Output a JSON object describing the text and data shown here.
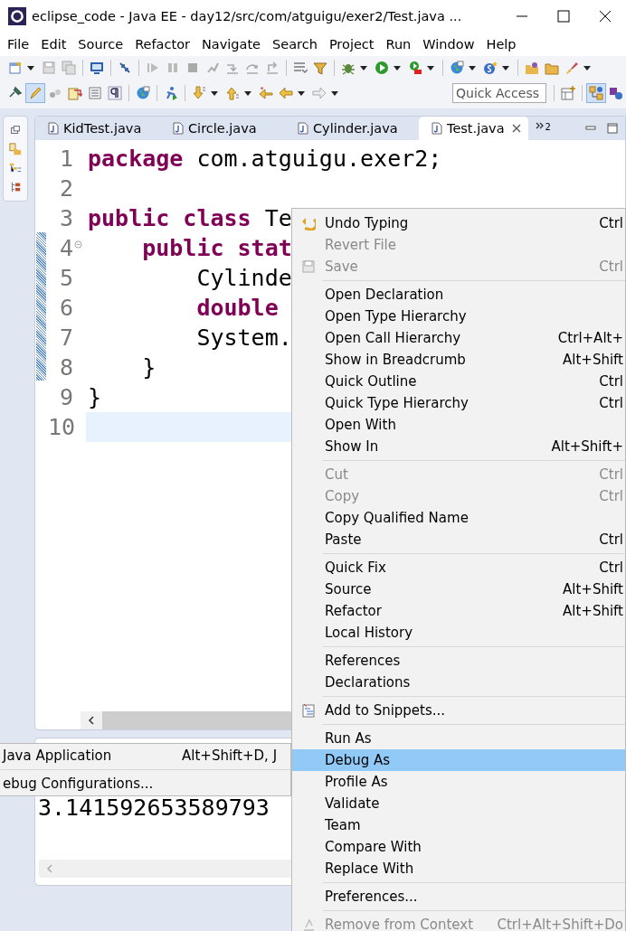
{
  "window": {
    "title": "eclipse_code - Java EE - day12/src/com/atguigu/exer2/Test.java ..."
  },
  "menu_bar": [
    "File",
    "Edit",
    "Source",
    "Refactor",
    "Navigate",
    "Search",
    "Project",
    "Run",
    "Window",
    "Help"
  ],
  "quick_access": {
    "placeholder": "Quick Access"
  },
  "editor": {
    "tabs": [
      {
        "label": "KidTest.java",
        "selected": false
      },
      {
        "label": "Circle.java",
        "selected": false
      },
      {
        "label": "Cylinder.java",
        "selected": false
      },
      {
        "label": "Test.java",
        "selected": true
      }
    ],
    "overflow_count": "2",
    "lines": [
      {
        "number": "1",
        "current": false,
        "tokens": [
          {
            "text": "package",
            "kind": "keyword"
          },
          {
            "text": " com.atguigu.exer2;",
            "kind": "plain"
          }
        ]
      },
      {
        "number": "2",
        "current": false
      },
      {
        "number": "3",
        "current": false,
        "tokens": [
          {
            "text": "public class",
            "kind": "keyword"
          },
          {
            "text": " Te",
            "kind": "plain"
          }
        ]
      },
      {
        "number": "4",
        "current": false,
        "tokens": [
          {
            "text": "    public stat",
            "kind": "keyword"
          }
        ]
      },
      {
        "number": "5",
        "current": false,
        "tokens": [
          {
            "text": "        Cylinde",
            "kind": "plain"
          }
        ]
      },
      {
        "number": "6",
        "current": false,
        "tokens": [
          {
            "text": "        double",
            "kind": "keyword"
          }
        ]
      },
      {
        "number": "7",
        "current": false,
        "tokens": [
          {
            "text": "        System.",
            "kind": "plain"
          }
        ]
      },
      {
        "number": "8",
        "current": false,
        "tokens": [
          {
            "text": "    }",
            "kind": "plain"
          }
        ]
      },
      {
        "number": "9",
        "current": false,
        "tokens": [
          {
            "text": "}",
            "kind": "plain"
          }
        ]
      },
      {
        "number": "10",
        "current": true
      }
    ]
  },
  "console": {
    "output": "3.141592653589793"
  },
  "context_menu": {
    "sections": [
      [
        {
          "label": "Undo Typing",
          "shortcut": "Ctrl",
          "disabled": false,
          "selected": false,
          "kind": "undo"
        },
        {
          "label": "Revert File",
          "disabled": true,
          "selected": false,
          "kind": "plain"
        },
        {
          "label": "Save",
          "shortcut": "Ctrl",
          "disabled": true,
          "selected": false,
          "kind": "save"
        }
      ],
      [
        {
          "label": "Open Declaration",
          "disabled": false,
          "selected": false,
          "kind": "plain"
        },
        {
          "label": "Open Type Hierarchy",
          "disabled": false,
          "selected": false,
          "kind": "plain"
        },
        {
          "label": "Open Call Hierarchy",
          "shortcut": "Ctrl+Alt+",
          "disabled": false,
          "selected": false,
          "kind": "plain"
        },
        {
          "label": "Show in Breadcrumb",
          "shortcut": "Alt+Shift",
          "disabled": false,
          "selected": false,
          "kind": "plain"
        },
        {
          "label": "Quick Outline",
          "shortcut": "Ctrl",
          "disabled": false,
          "selected": false,
          "kind": "plain"
        },
        {
          "label": "Quick Type Hierarchy",
          "shortcut": "Ctrl",
          "disabled": false,
          "selected": false,
          "kind": "plain"
        },
        {
          "label": "Open With",
          "disabled": false,
          "selected": false,
          "kind": "plain"
        },
        {
          "label": "Show In",
          "shortcut": "Alt+Shift+",
          "disabled": false,
          "selected": false,
          "kind": "plain"
        }
      ],
      [
        {
          "label": "Cut",
          "shortcut": "Ctrl",
          "disabled": true,
          "selected": false,
          "kind": "plain"
        },
        {
          "label": "Copy",
          "shortcut": "Ctrl",
          "disabled": true,
          "selected": false,
          "kind": "plain"
        },
        {
          "label": "Copy Qualified Name",
          "disabled": false,
          "selected": false,
          "kind": "plain"
        },
        {
          "label": "Paste",
          "shortcut": "Ctrl",
          "disabled": false,
          "selected": false,
          "kind": "plain"
        }
      ],
      [
        {
          "label": "Quick Fix",
          "shortcut": "Ctrl",
          "disabled": false,
          "selected": false,
          "kind": "plain"
        },
        {
          "label": "Source",
          "shortcut": "Alt+Shift",
          "disabled": false,
          "selected": false,
          "kind": "plain"
        },
        {
          "label": "Refactor",
          "shortcut": "Alt+Shift",
          "disabled": false,
          "selected": false,
          "kind": "plain"
        },
        {
          "label": "Local History",
          "disabled": false,
          "selected": false,
          "kind": "plain"
        }
      ],
      [
        {
          "label": "References",
          "disabled": false,
          "selected": false,
          "kind": "plain"
        },
        {
          "label": "Declarations",
          "disabled": false,
          "selected": false,
          "kind": "plain"
        }
      ],
      [
        {
          "label": "Add to Snippets...",
          "disabled": false,
          "selected": false,
          "kind": "snippet"
        }
      ],
      [
        {
          "label": "Run As",
          "disabled": false,
          "selected": false,
          "kind": "plain"
        },
        {
          "label": "Debug As",
          "disabled": false,
          "selected": true,
          "kind": "plain"
        },
        {
          "label": "Profile As",
          "disabled": false,
          "selected": false,
          "kind": "plain"
        },
        {
          "label": "Validate",
          "disabled": false,
          "selected": false,
          "kind": "plain"
        },
        {
          "label": "Team",
          "disabled": false,
          "selected": false,
          "kind": "plain"
        },
        {
          "label": "Compare With",
          "disabled": false,
          "selected": false,
          "kind": "plain"
        },
        {
          "label": "Replace With",
          "disabled": false,
          "selected": false,
          "kind": "plain"
        }
      ],
      [
        {
          "label": "Preferences...",
          "disabled": false,
          "selected": false,
          "kind": "plain"
        }
      ],
      [
        {
          "label": "Remove from Context",
          "shortcut": "Ctrl+Alt+Shift+Do",
          "disabled": true,
          "selected": false,
          "kind": "remove"
        }
      ]
    ]
  },
  "submenu": {
    "sections": [
      [
        {
          "label": "Java Application",
          "shortcut": "Alt+Shift+D, J"
        }
      ],
      [
        {
          "label": "ebug Configurations..."
        }
      ]
    ]
  }
}
